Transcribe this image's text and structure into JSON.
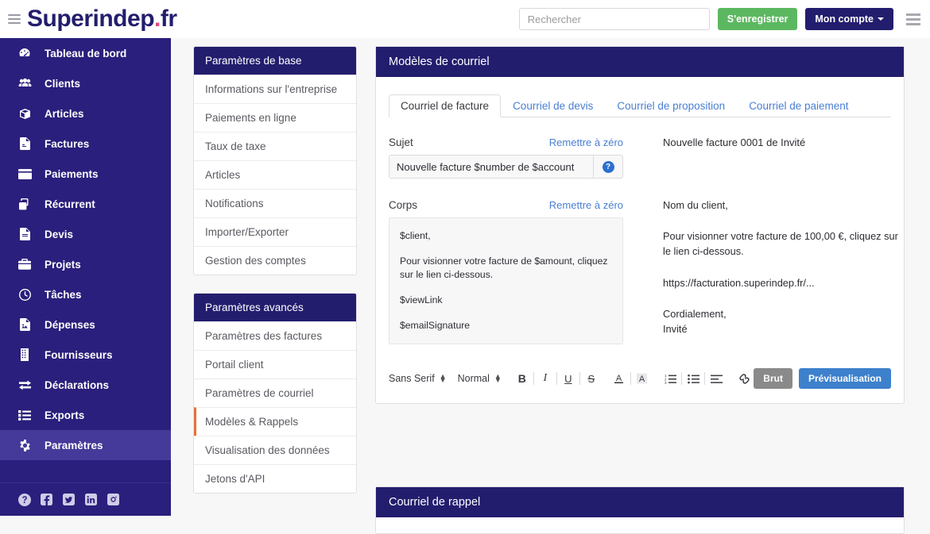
{
  "header": {
    "menu_icon": "hamburger-icon",
    "brand_main": "Superindep",
    "brand_dot": ".",
    "brand_sub": "fr",
    "search_placeholder": "Rechercher",
    "search_value": "",
    "signup_label": "S'enregistrer",
    "account_label": "Mon compte",
    "right_menu_icon": "hamburger-icon"
  },
  "sidebar": {
    "items": [
      {
        "label": "Tableau de bord",
        "icon": "dashboard-icon",
        "active": false
      },
      {
        "label": "Clients",
        "icon": "users-icon",
        "active": false
      },
      {
        "label": "Articles",
        "icon": "box-icon",
        "active": false
      },
      {
        "label": "Factures",
        "icon": "invoice-icon",
        "active": false
      },
      {
        "label": "Paiements",
        "icon": "credit-card-icon",
        "active": false
      },
      {
        "label": "Récurrent",
        "icon": "copy-icon",
        "active": false
      },
      {
        "label": "Devis",
        "icon": "document-icon",
        "active": false
      },
      {
        "label": "Projets",
        "icon": "briefcase-icon",
        "active": false
      },
      {
        "label": "Tâches",
        "icon": "clock-icon",
        "active": false
      },
      {
        "label": "Dépenses",
        "icon": "image-icon",
        "active": false
      },
      {
        "label": "Fournisseurs",
        "icon": "building-icon",
        "active": false
      },
      {
        "label": "Déclarations",
        "icon": "exchange-icon",
        "active": false
      },
      {
        "label": "Exports",
        "icon": "list-icon",
        "active": false
      },
      {
        "label": "Paramètres",
        "icon": "gear-icon",
        "active": true
      }
    ],
    "social": [
      {
        "name": "help-icon"
      },
      {
        "name": "facebook-icon"
      },
      {
        "name": "twitter-icon"
      },
      {
        "name": "linkedin-icon"
      },
      {
        "name": "instagram-icon"
      }
    ]
  },
  "settings_basic": {
    "title": "Paramètres de base",
    "items": [
      {
        "label": "Informations sur l'entreprise",
        "active": false
      },
      {
        "label": "Paiements en ligne",
        "active": false
      },
      {
        "label": "Taux de taxe",
        "active": false
      },
      {
        "label": "Articles",
        "active": false
      },
      {
        "label": "Notifications",
        "active": false
      },
      {
        "label": "Importer/Exporter",
        "active": false
      },
      {
        "label": "Gestion des comptes",
        "active": false
      }
    ]
  },
  "settings_advanced": {
    "title": "Paramètres avancés",
    "items": [
      {
        "label": "Paramètres des factures",
        "active": false
      },
      {
        "label": "Portail client",
        "active": false
      },
      {
        "label": "Paramètres de courriel",
        "active": false
      },
      {
        "label": "Modèles & Rappels",
        "active": true
      },
      {
        "label": "Visualisation des données",
        "active": false
      },
      {
        "label": "Jetons d'API",
        "active": false
      }
    ]
  },
  "main": {
    "card_title": "Modèles de courriel",
    "tabs": [
      {
        "label": "Courriel de facture",
        "active": true
      },
      {
        "label": "Courriel de devis",
        "active": false
      },
      {
        "label": "Courriel de proposition",
        "active": false
      },
      {
        "label": "Courriel de paiement",
        "active": false
      }
    ],
    "subject": {
      "label": "Sujet",
      "reset_label": "Remettre à zéro",
      "value": "Nouvelle facture $number de $account",
      "help_icon": "question-mark-icon",
      "help_glyph": "?"
    },
    "body": {
      "label": "Corps",
      "reset_label": "Remettre à zéro",
      "lines": [
        "$client,",
        "Pour visionner votre facture de $amount, cliquez sur le lien ci-dessous.",
        "$viewLink",
        "$emailSignature"
      ]
    },
    "preview": {
      "subject": "Nouvelle facture 0001 de Invité",
      "greeting": "Nom du client,",
      "paragraph": "Pour visionner votre facture de 100,00 €, cliquez sur le lien ci-dessous.",
      "link": "https://facturation.superindep.fr/...",
      "closing_line1": "Cordialement,",
      "closing_line2": "Invité"
    },
    "toolbar": {
      "font_family": "Sans Serif",
      "font_size": "Normal",
      "bold": "B",
      "italic": "I",
      "underline": "U",
      "strike": "S",
      "text_color_icon": "text-color-icon",
      "highlight_icon": "highlight-color-icon",
      "ordered_list_icon": "ordered-list-icon",
      "bullet_list_icon": "bullet-list-icon",
      "align_icon": "align-icon",
      "link_icon": "link-icon",
      "raw_label": "Brut",
      "preview_label": "Prévisualisation"
    }
  },
  "bottom": {
    "card_title": "Courriel de rappel"
  },
  "colors": {
    "brand_purple": "#231d6e",
    "sidebar_purple": "#2a1f7c",
    "sidebar_active": "#453a99",
    "accent_pink": "#e8457c",
    "accent_orange": "#e8703a",
    "link_blue": "#4a7fd4",
    "green": "#5cb860",
    "preview_button_blue": "#3d80cc",
    "raw_button_gray": "#8a8a8a"
  }
}
